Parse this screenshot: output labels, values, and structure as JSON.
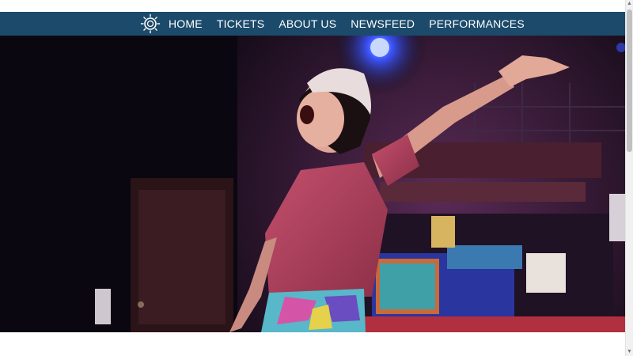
{
  "nav": {
    "logo_icon": "sun-ring-logo-icon",
    "items": [
      {
        "label": "HOME"
      },
      {
        "label": "TICKETS"
      },
      {
        "label": "ABOUT US"
      },
      {
        "label": "NEWSFEED"
      },
      {
        "label": "PERFORMANCES"
      }
    ]
  },
  "hero": {
    "image": "performer-singing-on-stage-photo"
  },
  "colors": {
    "nav_bg": "#1b4a6b",
    "nav_text": "#ffffff"
  }
}
